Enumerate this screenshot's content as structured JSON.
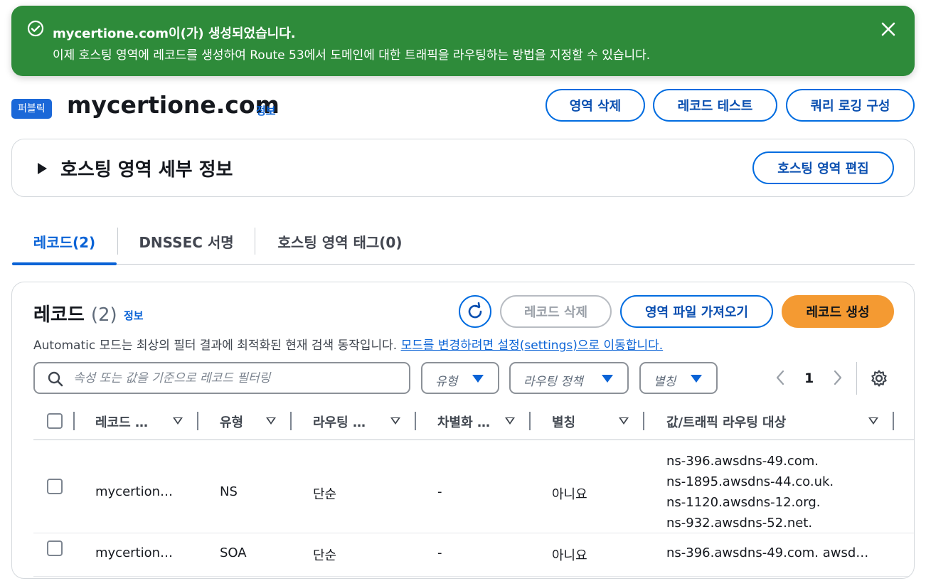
{
  "flash": {
    "title": "mycertione.com이(가) 생성되었습니다.",
    "message": "이제 호스팅 영역에 레코드를 생성하여 Route 53에서 도메인에 대한 트래픽을 라우팅하는 방법을 지정할 수 있습니다.",
    "color": "#2e8b3a"
  },
  "header": {
    "badge": "퍼블릭",
    "title": "mycertione.com",
    "info": "정보",
    "buttons": {
      "delete_zone": "영역 삭제",
      "test_record": "레코드 테스트",
      "query_logging": "쿼리 로깅 구성"
    }
  },
  "details": {
    "heading": "호스팅 영역 세부 정보",
    "edit_button": "호스팅 영역 편집"
  },
  "tabs": [
    {
      "label": "레코드(2)",
      "active": true
    },
    {
      "label": "DNSSEC 서명",
      "active": false
    },
    {
      "label": "호스팅 영역 태그(0)",
      "active": false
    }
  ],
  "records": {
    "title": "레코드",
    "count": "(2)",
    "info": "정보",
    "delete_button": "레코드 삭제",
    "import_button": "영역 파일 가져오기",
    "create_button": "레코드 생성",
    "description": "Automatic 모드는 최상의 필터 결과에 최적화된 현재 검색 동작입니다.",
    "description_link": "모드를 변경하려면 설정(settings)으로 이동합니다.",
    "search_placeholder": "속성 또는 값을 기준으로 레코드 필터링",
    "filters": {
      "type": "유형",
      "routing_policy": "라우팅 정책",
      "alias": "별칭"
    },
    "page": "1",
    "columns": [
      "레코드 …",
      "유형",
      "라우팅 …",
      "차별화 …",
      "별칭",
      "값/트래픽 라우팅 대상"
    ],
    "rows": [
      {
        "name": "mycertion…",
        "type": "NS",
        "routing": "단순",
        "differentiator": "-",
        "alias": "아니요",
        "values": [
          "ns-396.awsdns-49.com.",
          "ns-1895.awsdns-44.co.uk.",
          "ns-1120.awsdns-12.org.",
          "ns-932.awsdns-52.net."
        ]
      },
      {
        "name": "mycertion…",
        "type": "SOA",
        "routing": "단순",
        "differentiator": "-",
        "alias": "아니요",
        "values": [
          "ns-396.awsdns-49.com. awsd…"
        ]
      }
    ]
  },
  "colors": {
    "accent": "#0a63d6",
    "primary_button": "#f49a32"
  }
}
